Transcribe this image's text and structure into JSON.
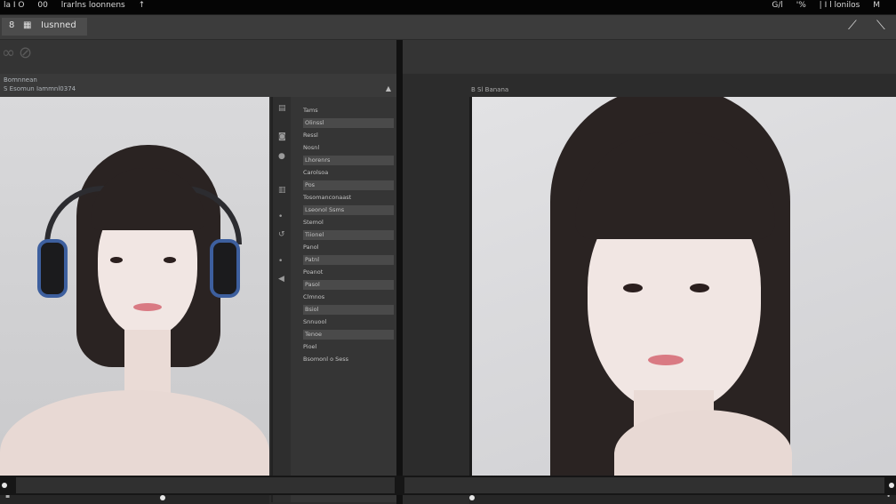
{
  "topbar": {
    "left_items": [
      "la I O",
      "00",
      "lrarlns loonnens",
      "↑"
    ],
    "right_items": [
      "G/l",
      "'%",
      "| I l lonilos",
      "M"
    ]
  },
  "toolbar": {
    "tab_number": "8",
    "tab_icon": "grid-icon",
    "tab_label": "Iusnned",
    "right_icons": [
      "pen-tool-icon",
      "brush-icon"
    ]
  },
  "left_pane": {
    "sub_lines": [
      "Bomnnean",
      "S Esomun Iammnl0374"
    ],
    "properties": [
      "Tams",
      "Olinssl",
      "Ressl",
      "Nosnl",
      "Lhorenrs",
      "Carolsoa",
      "Pos",
      "Tosomanconaast",
      "Lseonol Ssms",
      "Stemol",
      "Tiionel",
      "Panol",
      "Patnl",
      "Poanot",
      "Pasol",
      "Clmnos",
      "Bsiol",
      "Snnuool",
      "Tenoe",
      "Pioel",
      "Bsomonl o Sess"
    ],
    "gutter_icons": [
      "file-icon",
      "box-icon",
      "drop-icon",
      "layers-icon",
      "dot-icon",
      "rotate-icon",
      "dot-icon",
      "arrow-icon"
    ]
  },
  "right_pane": {
    "canvas_title": "B Sl Banana"
  },
  "colors": {
    "background": "#1e1e1e",
    "panel": "#2c2c2c",
    "headphone_accent": "#3d5f9e"
  }
}
